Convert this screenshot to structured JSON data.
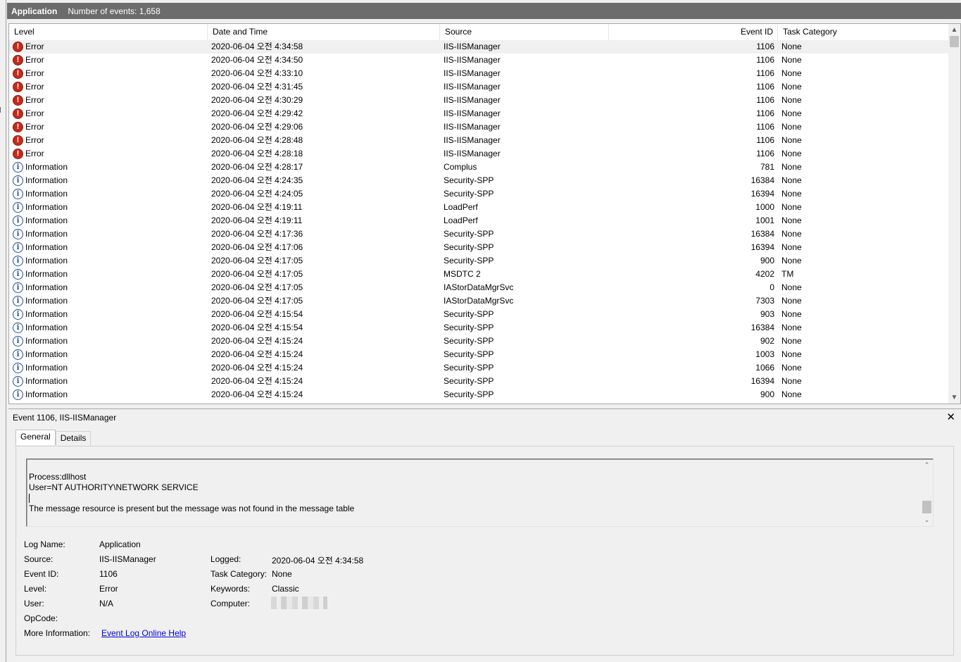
{
  "window": {
    "title": "Application",
    "event_count": "Number of events: 1,658"
  },
  "columns": {
    "level": "Level",
    "date": "Date and Time",
    "source": "Source",
    "event_id": "Event ID",
    "task_category": "Task Category"
  },
  "events": [
    {
      "level": "Error",
      "type": "error",
      "date": "2020-06-04 오전 4:34:58",
      "source": "IIS-IISManager",
      "id": "1106",
      "category": "None"
    },
    {
      "level": "Error",
      "type": "error",
      "date": "2020-06-04 오전 4:34:50",
      "source": "IIS-IISManager",
      "id": "1106",
      "category": "None"
    },
    {
      "level": "Error",
      "type": "error",
      "date": "2020-06-04 오전 4:33:10",
      "source": "IIS-IISManager",
      "id": "1106",
      "category": "None"
    },
    {
      "level": "Error",
      "type": "error",
      "date": "2020-06-04 오전 4:31:45",
      "source": "IIS-IISManager",
      "id": "1106",
      "category": "None"
    },
    {
      "level": "Error",
      "type": "error",
      "date": "2020-06-04 오전 4:30:29",
      "source": "IIS-IISManager",
      "id": "1106",
      "category": "None"
    },
    {
      "level": "Error",
      "type": "error",
      "date": "2020-06-04 오전 4:29:42",
      "source": "IIS-IISManager",
      "id": "1106",
      "category": "None"
    },
    {
      "level": "Error",
      "type": "error",
      "date": "2020-06-04 오전 4:29:06",
      "source": "IIS-IISManager",
      "id": "1106",
      "category": "None"
    },
    {
      "level": "Error",
      "type": "error",
      "date": "2020-06-04 오전 4:28:48",
      "source": "IIS-IISManager",
      "id": "1106",
      "category": "None"
    },
    {
      "level": "Error",
      "type": "error",
      "date": "2020-06-04 오전 4:28:18",
      "source": "IIS-IISManager",
      "id": "1106",
      "category": "None"
    },
    {
      "level": "Information",
      "type": "info",
      "date": "2020-06-04 오전 4:28:17",
      "source": "Complus",
      "id": "781",
      "category": "None"
    },
    {
      "level": "Information",
      "type": "info",
      "date": "2020-06-04 오전 4:24:35",
      "source": "Security-SPP",
      "id": "16384",
      "category": "None"
    },
    {
      "level": "Information",
      "type": "info",
      "date": "2020-06-04 오전 4:24:05",
      "source": "Security-SPP",
      "id": "16394",
      "category": "None"
    },
    {
      "level": "Information",
      "type": "info",
      "date": "2020-06-04 오전 4:19:11",
      "source": "LoadPerf",
      "id": "1000",
      "category": "None"
    },
    {
      "level": "Information",
      "type": "info",
      "date": "2020-06-04 오전 4:19:11",
      "source": "LoadPerf",
      "id": "1001",
      "category": "None"
    },
    {
      "level": "Information",
      "type": "info",
      "date": "2020-06-04 오전 4:17:36",
      "source": "Security-SPP",
      "id": "16384",
      "category": "None"
    },
    {
      "level": "Information",
      "type": "info",
      "date": "2020-06-04 오전 4:17:06",
      "source": "Security-SPP",
      "id": "16394",
      "category": "None"
    },
    {
      "level": "Information",
      "type": "info",
      "date": "2020-06-04 오전 4:17:05",
      "source": "Security-SPP",
      "id": "900",
      "category": "None"
    },
    {
      "level": "Information",
      "type": "info",
      "date": "2020-06-04 오전 4:17:05",
      "source": "MSDTC 2",
      "id": "4202",
      "category": "TM"
    },
    {
      "level": "Information",
      "type": "info",
      "date": "2020-06-04 오전 4:17:05",
      "source": "IAStorDataMgrSvc",
      "id": "0",
      "category": "None"
    },
    {
      "level": "Information",
      "type": "info",
      "date": "2020-06-04 오전 4:17:05",
      "source": "IAStorDataMgrSvc",
      "id": "7303",
      "category": "None"
    },
    {
      "level": "Information",
      "type": "info",
      "date": "2020-06-04 오전 4:15:54",
      "source": "Security-SPP",
      "id": "903",
      "category": "None"
    },
    {
      "level": "Information",
      "type": "info",
      "date": "2020-06-04 오전 4:15:54",
      "source": "Security-SPP",
      "id": "16384",
      "category": "None"
    },
    {
      "level": "Information",
      "type": "info",
      "date": "2020-06-04 오전 4:15:24",
      "source": "Security-SPP",
      "id": "902",
      "category": "None"
    },
    {
      "level": "Information",
      "type": "info",
      "date": "2020-06-04 오전 4:15:24",
      "source": "Security-SPP",
      "id": "1003",
      "category": "None"
    },
    {
      "level": "Information",
      "type": "info",
      "date": "2020-06-04 오전 4:15:24",
      "source": "Security-SPP",
      "id": "1066",
      "category": "None"
    },
    {
      "level": "Information",
      "type": "info",
      "date": "2020-06-04 오전 4:15:24",
      "source": "Security-SPP",
      "id": "16394",
      "category": "None"
    },
    {
      "level": "Information",
      "type": "info",
      "date": "2020-06-04 오전 4:15:24",
      "source": "Security-SPP",
      "id": "900",
      "category": "None"
    }
  ],
  "details": {
    "header": "Event 1106, IIS-IISManager",
    "tabs": [
      "General",
      "Details"
    ],
    "message_lines": [
      "Process:dllhost",
      "User=NT AUTHORITY\\NETWORK SERVICE",
      "The message resource is present but the message was not found in the message table"
    ],
    "labels": {
      "log_name": "Log Name:",
      "source": "Source:",
      "event_id": "Event ID:",
      "level": "Level:",
      "user": "User:",
      "opcode": "OpCode:",
      "more_info": "More Information:",
      "logged": "Logged:",
      "task_category": "Task Category:",
      "keywords": "Keywords:",
      "computer": "Computer:"
    },
    "values": {
      "log_name": "Application",
      "source": "IIS-IISManager",
      "event_id": "1106",
      "level": "Error",
      "user": "N/A",
      "more_info_link": "Event Log Online Help",
      "logged": "2020-06-04 오전 4:34:58",
      "task_category": "None",
      "keywords": "Classic"
    }
  },
  "colors": {
    "title_bar": "#6c6c6c",
    "selected_row": "#f0f0f0",
    "error_icon": "#c42b1c",
    "info_icon": "#1f4e9b",
    "link": "#0000e0"
  },
  "icons": {
    "error": "error-icon",
    "info": "info-icon",
    "close": "close-icon"
  }
}
